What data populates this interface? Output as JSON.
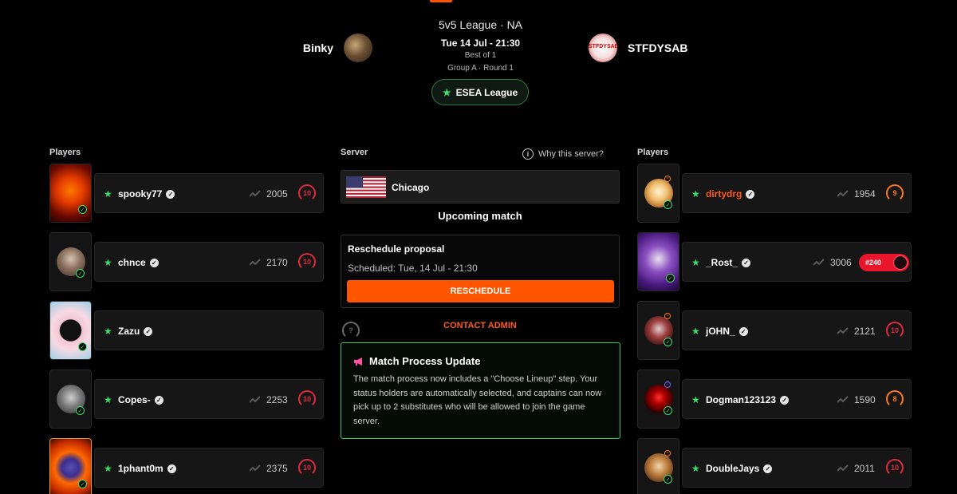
{
  "match": {
    "league_title": "5v5 League · NA",
    "datetime": "Tue 14 Jul - 21:30",
    "best_of": "Best of 1",
    "group_round": "Group A · Round 1",
    "league_badge": "ESEA League",
    "team_left": "Binky",
    "team_right": "STFDYSAB",
    "team_right_avatar_text": "STFDYSAB"
  },
  "left": {
    "heading": "Players",
    "players": [
      {
        "name": "spooky77",
        "elo": "2005",
        "level": "10"
      },
      {
        "name": "chnce",
        "elo": "2170",
        "level": "10"
      },
      {
        "name": "Zazu",
        "elo": "",
        "level": "?"
      },
      {
        "name": "Copes-",
        "elo": "2253",
        "level": "10"
      },
      {
        "name": "1phant0m",
        "elo": "2375",
        "level": "10"
      }
    ]
  },
  "right": {
    "heading": "Players",
    "players": [
      {
        "name": "dirtydrg",
        "elo": "1954",
        "level": "9"
      },
      {
        "name": "_Rost_",
        "elo": "3006",
        "rank": "#240"
      },
      {
        "name": "jOHN_",
        "elo": "2121",
        "level": "10"
      },
      {
        "name": "Dogman123123",
        "elo": "1590",
        "level": "8"
      },
      {
        "name": "DoubleJays",
        "elo": "2011",
        "level": "10"
      }
    ]
  },
  "server": {
    "heading": "Server",
    "why_link": "Why this server?",
    "location": "Chicago",
    "status": "Upcoming match"
  },
  "reschedule": {
    "title": "Reschedule proposal",
    "scheduled": "Scheduled: Tue, 14 Jul - 21:30",
    "button": "RESCHEDULE"
  },
  "contact_admin": "CONTACT ADMIN",
  "update": {
    "title": "Match Process Update",
    "body": "The match process now includes a \"Choose Lineup\" step. Your status holders are automatically selected, and captains can now pick up to 2 substitutes who will be allowed to join the game server."
  },
  "colors": {
    "accent": "#ff5500",
    "green": "#3ddc6c",
    "level_red": "#e02a3d",
    "level_orange": "#ff7a1a"
  }
}
